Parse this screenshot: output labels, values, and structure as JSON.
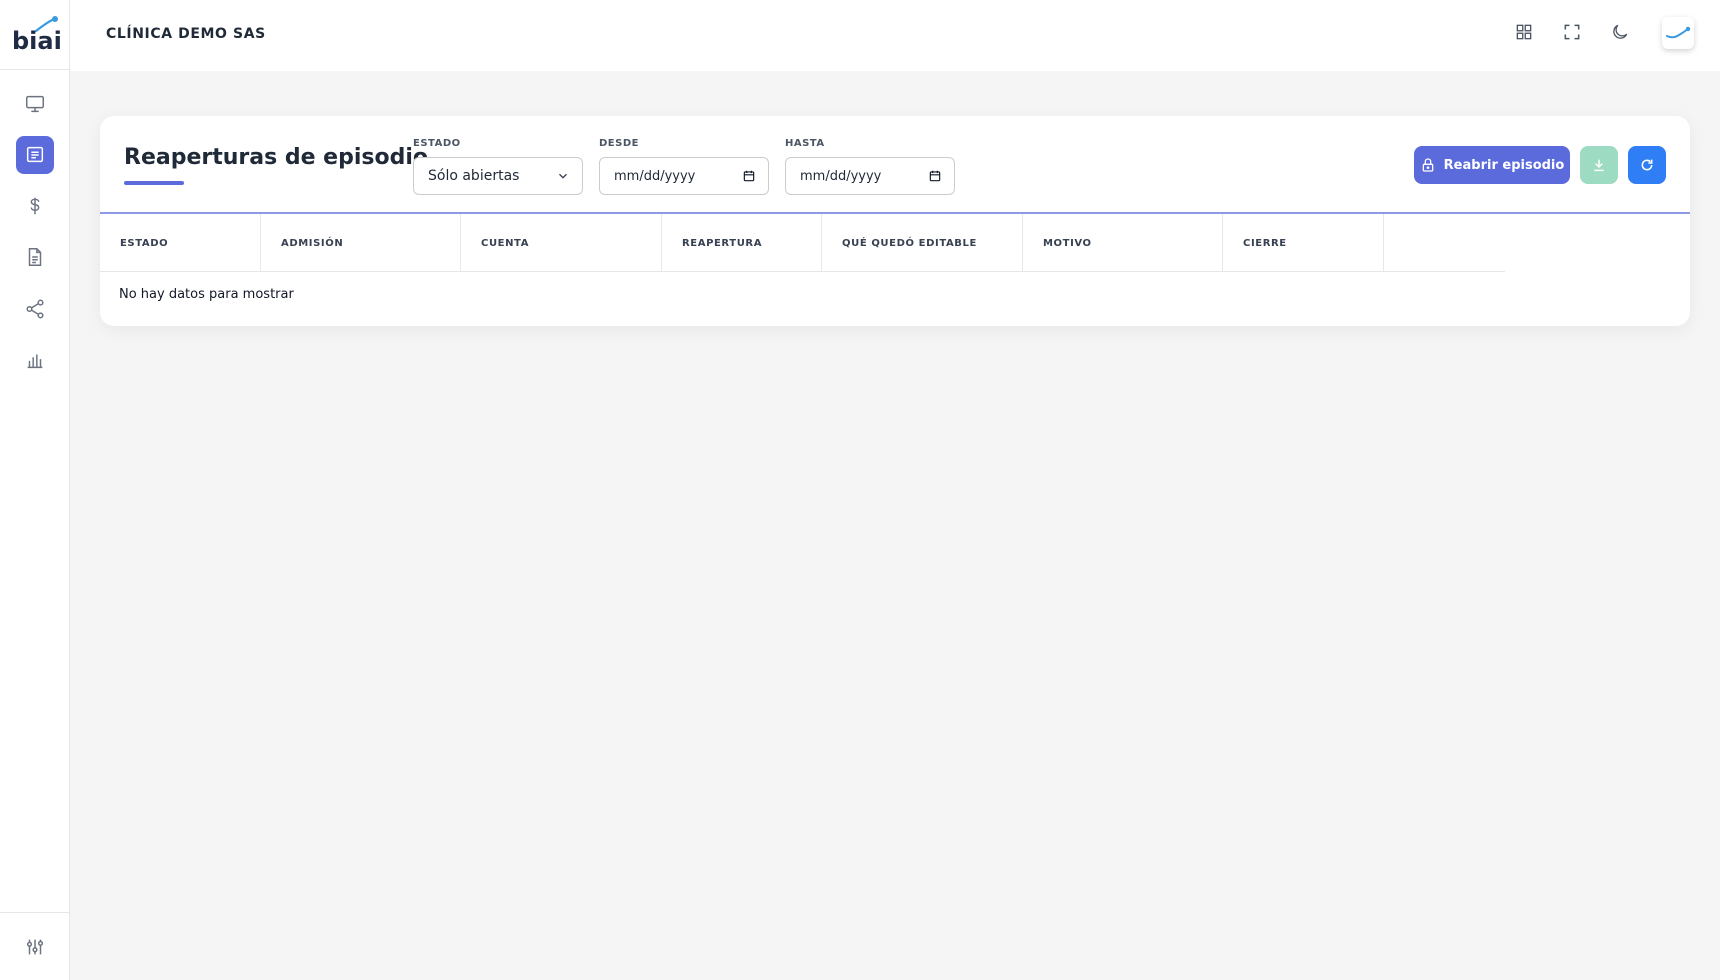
{
  "sidebar": {
    "logo_text": "biai",
    "items": [
      {
        "icon": "monitor-icon",
        "active": false
      },
      {
        "icon": "receipt-icon",
        "active": true
      },
      {
        "icon": "dollar-icon",
        "active": false
      },
      {
        "icon": "document-icon",
        "active": false
      },
      {
        "icon": "share-icon",
        "active": false
      },
      {
        "icon": "bar-chart-icon",
        "active": false
      }
    ],
    "bottom_item": {
      "icon": "sliders-icon"
    }
  },
  "header": {
    "org_name": "CLÍNICA DEMO SAS",
    "actions": [
      "grid-icon",
      "fullscreen-icon",
      "moon-icon"
    ],
    "avatar_icon": "brand-mark-icon"
  },
  "card": {
    "title": "Reaperturas de episodio",
    "filters": {
      "estado": {
        "label": "ESTADO",
        "value": "Sólo abiertas"
      },
      "desde": {
        "label": "DESDE",
        "placeholder": "mm/dd/yyyy"
      },
      "hasta": {
        "label": "HASTA",
        "placeholder": "mm/dd/yyyy"
      }
    },
    "buttons": {
      "reopen_label": "Reabrir episodio",
      "download_icon": "download-icon",
      "refresh_icon": "refresh-icon"
    },
    "table": {
      "columns": [
        "ESTADO",
        "ADMISIÓN",
        "CUENTA",
        "REAPERTURA",
        "QUÉ QUEDÓ EDITABLE",
        "MOTIVO",
        "CIERRE"
      ],
      "rows": [],
      "empty_message": "No hay datos para mostrar"
    }
  },
  "colors": {
    "accent": "#5c6bdc",
    "download": "#9ddbc3",
    "refresh": "#2f7ef5",
    "background": "#f5f5f5"
  }
}
